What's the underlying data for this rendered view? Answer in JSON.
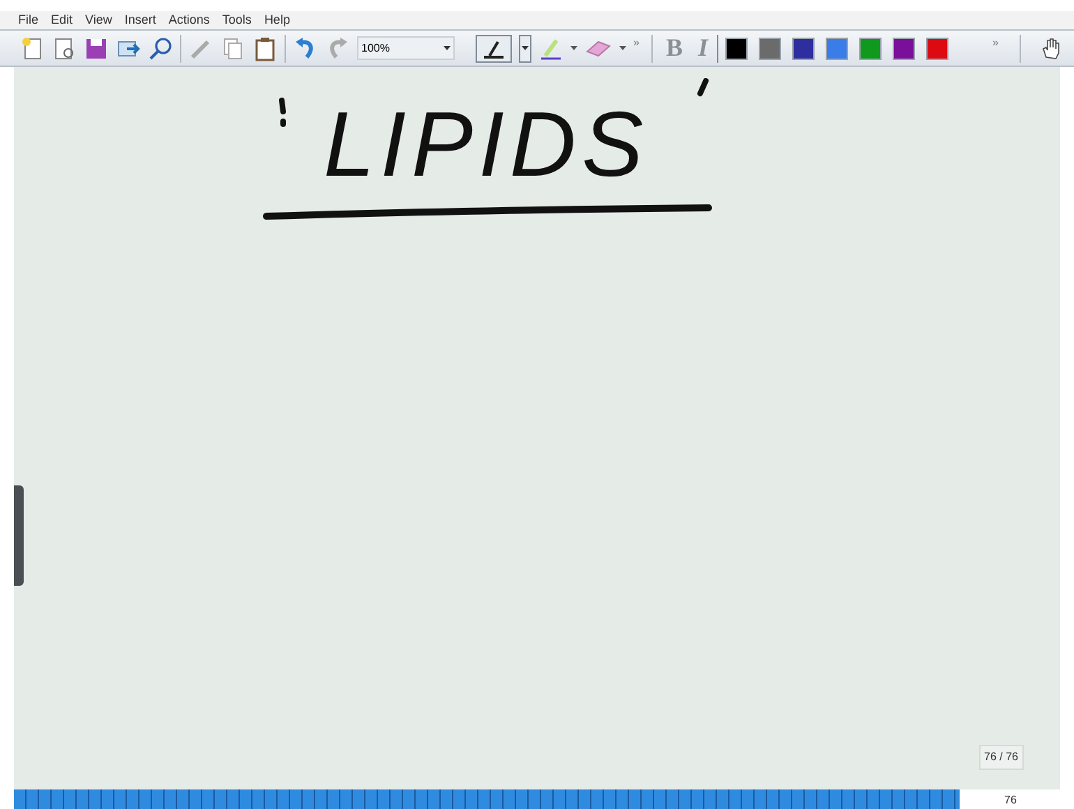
{
  "menu": [
    "File",
    "Edit",
    "View",
    "Insert",
    "Actions",
    "Tools",
    "Help"
  ],
  "toolbar": {
    "zoom": "100%",
    "overflow_1": "»",
    "bold": "B",
    "italic": "I",
    "overflow_2": "»",
    "colors": [
      {
        "color": "#000000"
      },
      {
        "color": "#6b6b6b"
      },
      {
        "color": "#2e2e9e"
      },
      {
        "color": "#3a7de8"
      },
      {
        "color": "#0f9a1e"
      },
      {
        "color": "#7a0f9a"
      },
      {
        "color": "#dd0a12"
      }
    ]
  },
  "canvas": {
    "ink_text": "LIPIDS"
  },
  "page_indicator": "76 / 76",
  "page_number": "76"
}
